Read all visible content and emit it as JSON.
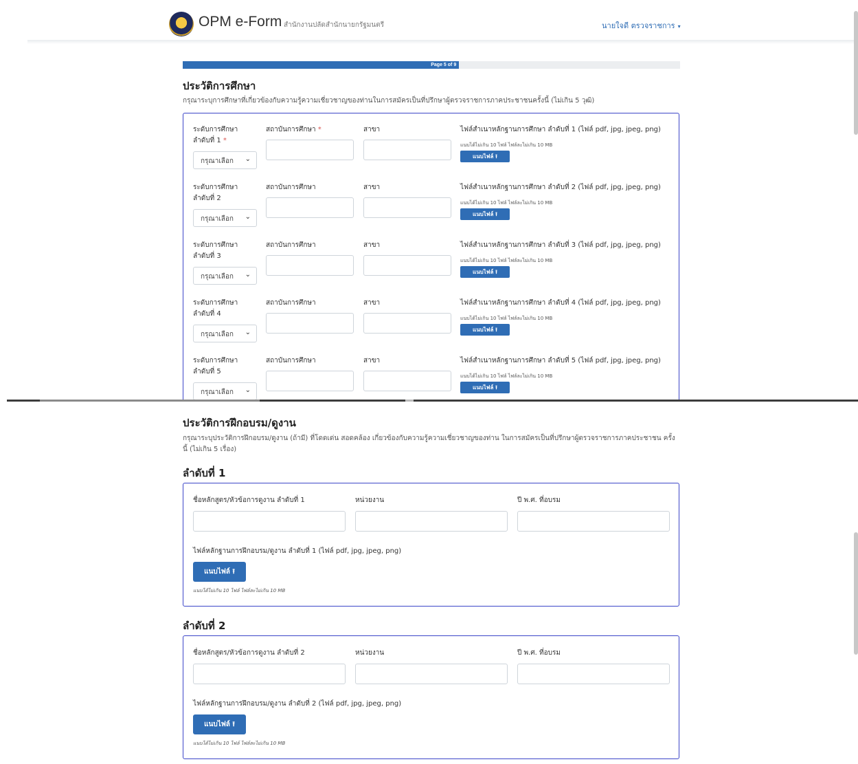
{
  "navbar": {
    "brand": "OPM e-Form",
    "subtitle": "สำนักงานปลัดสำนักนายกรัฐมนตรี",
    "user": "นายใจดี ตรวจราชการ",
    "caret": "▾"
  },
  "progress": {
    "label": "Page 5 of 9",
    "current": 5,
    "total": 9
  },
  "education": {
    "title": "ประวัติการศึกษา",
    "description": "กรุณาระบุการศึกษาที่เกี่ยวข้องกับความรู้ความเชี่ยวชาญของท่านในการสมัครเป็นที่ปรึกษาผู้ตรวจราชการภาคประชาชนครั้งนี้ (ไม่เกิน 5 วุฒิ)",
    "rows": [
      {
        "level_label": "ระดับการศึกษา ลำดับที่ 1",
        "required": "*",
        "select_value": "กรุณาเลือก",
        "institution_label": "สถาบันการศึกษา",
        "institution_required": "*",
        "major_label": "สาขา",
        "file_label": "ไฟล์สำเนาหลักฐานการศึกษา ลำดับที่ 1 (ไฟล์ pdf, jpg, jpeg, png)",
        "file_hint": "แนบได้ไม่เกิน 10 ไฟล์ ไฟล์ละไม่เกิน 10 MB",
        "button": "แนบไฟล์ ⭱"
      },
      {
        "level_label": "ระดับการศึกษา ลำดับที่ 2",
        "required": "",
        "select_value": "กรุณาเลือก",
        "institution_label": "สถาบันการศึกษา",
        "institution_required": "",
        "major_label": "สาขา",
        "file_label": "ไฟล์สำเนาหลักฐานการศึกษา ลำดับที่ 2 (ไฟล์ pdf, jpg, jpeg, png)",
        "file_hint": "แนบได้ไม่เกิน 10 ไฟล์ ไฟล์ละไม่เกิน 10 MB",
        "button": "แนบไฟล์ ⭱"
      },
      {
        "level_label": "ระดับการศึกษา ลำดับที่ 3",
        "required": "",
        "select_value": "กรุณาเลือก",
        "institution_label": "สถาบันการศึกษา",
        "institution_required": "",
        "major_label": "สาขา",
        "file_label": "ไฟล์สำเนาหลักฐานการศึกษา ลำดับที่ 3 (ไฟล์ pdf, jpg, jpeg, png)",
        "file_hint": "แนบได้ไม่เกิน 10 ไฟล์ ไฟล์ละไม่เกิน 10 MB",
        "button": "แนบไฟล์ ⭱"
      },
      {
        "level_label": "ระดับการศึกษา ลำดับที่ 4",
        "required": "",
        "select_value": "กรุณาเลือก",
        "institution_label": "สถาบันการศึกษา",
        "institution_required": "",
        "major_label": "สาขา",
        "file_label": "ไฟล์สำเนาหลักฐานการศึกษา ลำดับที่ 4 (ไฟล์ pdf, jpg, jpeg, png)",
        "file_hint": "แนบได้ไม่เกิน 10 ไฟล์ ไฟล์ละไม่เกิน 10 MB",
        "button": "แนบไฟล์ ⭱"
      },
      {
        "level_label": "ระดับการศึกษา ลำดับที่ 5",
        "required": "",
        "select_value": "กรุณาเลือก",
        "institution_label": "สถาบันการศึกษา",
        "institution_required": "",
        "major_label": "สาขา",
        "file_label": "ไฟล์สำเนาหลักฐานการศึกษา ลำดับที่ 5 (ไฟล์ pdf, jpg, jpeg, png)",
        "file_hint": "แนบได้ไม่เกิน 10 ไฟล์ ไฟล์ละไม่เกิน 10 MB",
        "button": "แนบไฟล์ ⭱"
      }
    ]
  },
  "training": {
    "title": "ประวัติการฝึกอบรม/ดูงาน",
    "description": "กรุณาระบุประวัติการฝึกอบรม/ดูงาน (ถ้ามี) ที่โดดเด่น สอดคล้อง เกี่ยวข้องกับความรู้ความเชี่ยวชาญของท่าน ในการสมัครเป็นที่ปรึกษาผู้ตรวจราชการภาคประชาชน ครั้งนี้ (ไม่เกิน 5 เรื่อง)",
    "items": [
      {
        "heading": "ลำดับที่ 1",
        "course_label": "ชื่อหลักสูตร/หัวข้อการดูงาน ลำดับที่ 1",
        "agency_label": "หน่วยงาน",
        "year_label": "ปี พ.ศ. ที่อบรม",
        "file_label": "ไฟล์หลักฐานการฝึกอบรม/ดูงาน ลำดับที่ 1 (ไฟล์ pdf, jpg, jpeg, png)",
        "button": "แนบไฟล์ ⭱",
        "hint": "แนบได้ไม่เกิน 10 ไฟล์ ไฟล์ละไม่เกิน 10 MB"
      },
      {
        "heading": "ลำดับที่ 2",
        "course_label": "ชื่อหลักสูตร/หัวข้อการดูงาน ลำดับที่ 2",
        "agency_label": "หน่วยงาน",
        "year_label": "ปี พ.ศ. ที่อบรม",
        "file_label": "ไฟล์หลักฐานการฝึกอบรม/ดูงาน ลำดับที่ 2 (ไฟล์ pdf, jpg, jpeg, png)",
        "button": "แนบไฟล์ ⭱",
        "hint": "แนบได้ไม่เกิน 10 ไฟล์ ไฟล์ละไม่เกิน 10 MB"
      }
    ]
  },
  "colors": {
    "primary": "#2f6db5",
    "border_accent": "#3b45c8",
    "required": "#d9534f"
  }
}
